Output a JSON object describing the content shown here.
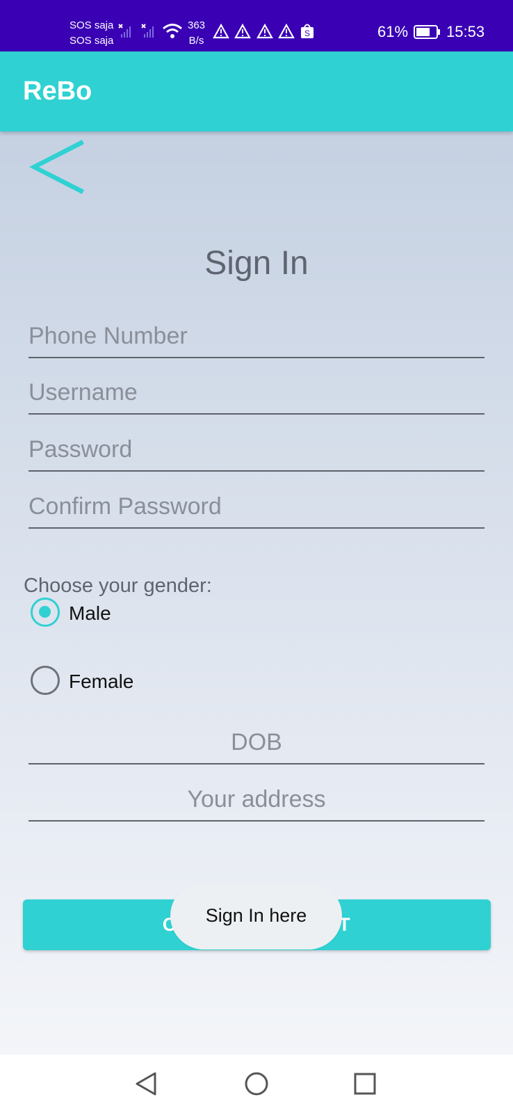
{
  "status_bar": {
    "carrier1": "SOS saja",
    "carrier2": "SOS saja",
    "net_speed_value": "363",
    "net_speed_unit": "B/s",
    "battery": "61%",
    "time": "15:53"
  },
  "app_bar": {
    "title": "ReBo"
  },
  "form": {
    "title": "Sign In",
    "phone_placeholder": "Phone Number",
    "username_placeholder": "Username",
    "password_placeholder": "Password",
    "confirm_placeholder": "Confirm Password",
    "gender_label": "Choose your gender:",
    "gender_options": [
      {
        "label": "Male",
        "selected": true
      },
      {
        "label": "Female",
        "selected": false
      }
    ],
    "dob_placeholder": "DOB",
    "address_placeholder": "Your address",
    "create_button": "CREATE ACCOUNT"
  },
  "toast": {
    "text": "Sign In here"
  },
  "colors": {
    "accent": "#30d1d2",
    "status_bar": "#3a00b4"
  },
  "icons": [
    "back-arrow-icon",
    "wifi-icon",
    "signal-icon",
    "warning-icon",
    "shopping-bag-icon",
    "battery-icon",
    "nav-back-icon",
    "nav-home-icon",
    "nav-recent-icon"
  ]
}
